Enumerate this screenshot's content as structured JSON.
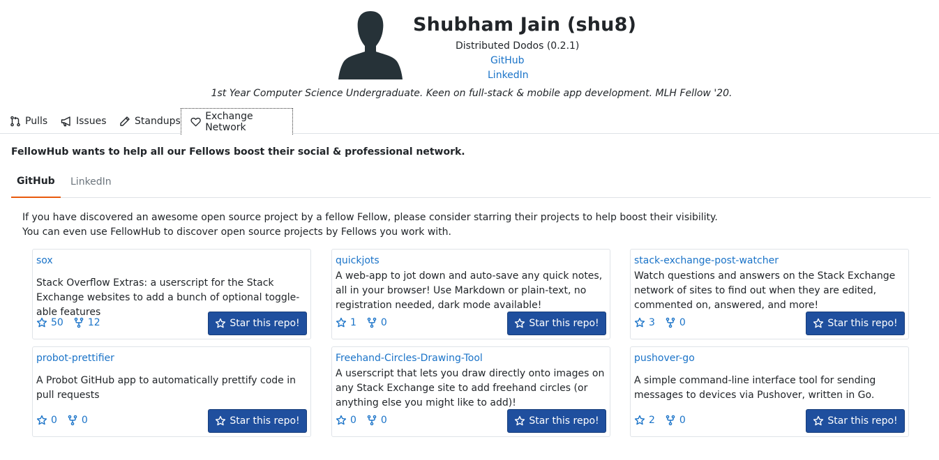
{
  "profile": {
    "name": "Shubham Jain (shu8)",
    "team": "Distributed Dodos (0.2.1)",
    "github_link": "GitHub",
    "linkedin_link": "LinkedIn",
    "bio": "1st Year Computer Science Undergraduate. Keen on full-stack & mobile app development. MLH Fellow '20."
  },
  "nav": {
    "pulls": "Pulls",
    "issues": "Issues",
    "standups": "Standups",
    "exchange": "Exchange Network"
  },
  "section": {
    "intro": "FellowHub wants to help all our Fellows boost their social & professional network.",
    "tabs": [
      "GitHub",
      "LinkedIn"
    ],
    "desc_line1": "If you have discovered an awesome open source project by a fellow Fellow, please consider starring their projects to help boost their visibility.",
    "desc_line2": "You can even use FellowHub to discover open source projects by Fellows you work with."
  },
  "repos": [
    {
      "name": "sox",
      "description": "Stack Overflow Extras: a userscript for the Stack Exchange websites to add a bunch of optional toggle-able features",
      "stars": "50",
      "forks": "12",
      "button": "Star this repo!"
    },
    {
      "name": "quickjots",
      "description": "A web-app to jot down and auto-save any quick notes, all in your browser! Use Markdown or plain-text, no registration needed, dark mode available!",
      "stars": "1",
      "forks": "0",
      "button": "Star this repo!"
    },
    {
      "name": "stack-exchange-post-watcher",
      "description": "Watch questions and answers on the Stack Exchange network of sites to find out when they are edited, commented on, answered, and more!",
      "stars": "3",
      "forks": "0",
      "button": "Star this repo!"
    },
    {
      "name": "probot-prettifier",
      "description": "A Probot GitHub app to automatically prettify code in pull requests",
      "stars": "0",
      "forks": "0",
      "button": "Star this repo!"
    },
    {
      "name": "Freehand-Circles-Drawing-Tool",
      "description": "A userscript that lets you draw directly onto images on any Stack Exchange site to add freehand circles (or anything else you might like to add)!",
      "stars": "0",
      "forks": "0",
      "button": "Star this repo!"
    },
    {
      "name": "pushover-go",
      "description": "A simple command-line interface tool for sending messages to devices via Pushover, written in Go.",
      "stars": "2",
      "forks": "0",
      "button": "Star this repo!"
    }
  ],
  "colors": {
    "accent_link": "#1a73c8",
    "button_bg": "#1f4f9e",
    "active_tab_underline": "#e8590c"
  },
  "icons": [
    "avatar-silhouette",
    "pull-request-icon",
    "megaphone-icon",
    "pencil-icon",
    "heart-icon",
    "star-icon",
    "fork-icon"
  ]
}
